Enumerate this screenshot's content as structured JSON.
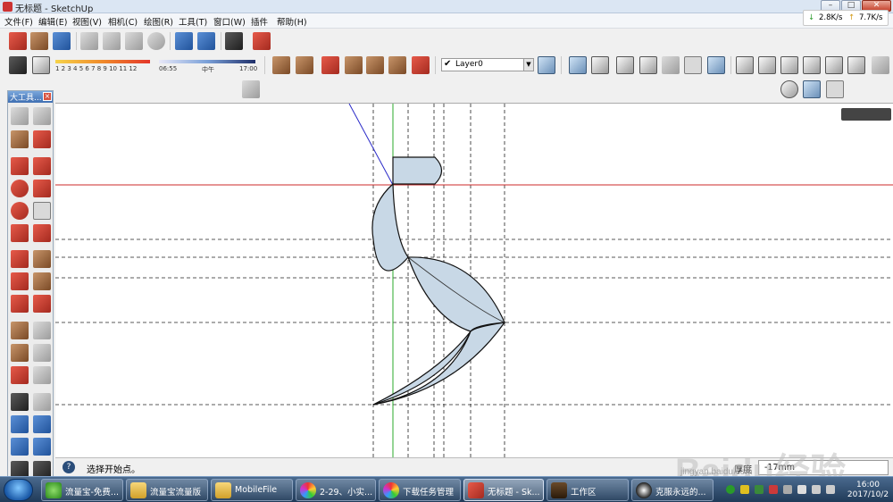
{
  "window": {
    "title": "无标题 - SketchUp"
  },
  "menu": [
    "文件(F)",
    "编辑(E)",
    "视图(V)",
    "相机(C)",
    "绘图(R)",
    "工具(T)",
    "窗口(W)",
    "插件",
    "帮助(H)"
  ],
  "network": {
    "down": "2.8K/s",
    "up": "7.7K/s"
  },
  "shadow": {
    "month_ticks": "1 2 3 4 5 6 7 8 9 10 11 12",
    "time_start": "06:55",
    "time_mid": "中午",
    "time_end": "17:00"
  },
  "layer": {
    "current": "Layer0"
  },
  "tool_palette": {
    "title": "大工具..."
  },
  "status": {
    "message": "选择开始点。",
    "vcb_label": "厚度",
    "vcb_value": "-17mm"
  },
  "taskbar": {
    "items": [
      {
        "label": "流量宝-免费..."
      },
      {
        "label": "流量宝流量版"
      },
      {
        "label": "MobileFile"
      },
      {
        "label": "2-29、小实..."
      },
      {
        "label": "下载任务管理"
      },
      {
        "label": "无标题 - Sk..."
      },
      {
        "label": "工作区"
      },
      {
        "label": "克服永远的..."
      }
    ],
    "clock": {
      "time": "16:00",
      "date": "2017/10/2"
    }
  },
  "watermark": {
    "text": "Baidu经验",
    "sub": "jingyan.baidu.com"
  },
  "colors": {
    "red_axis": "#cc2a2a",
    "green_axis": "#2aa82a",
    "blue_axis": "#2a2ac8",
    "face": "#c8d8e6"
  }
}
